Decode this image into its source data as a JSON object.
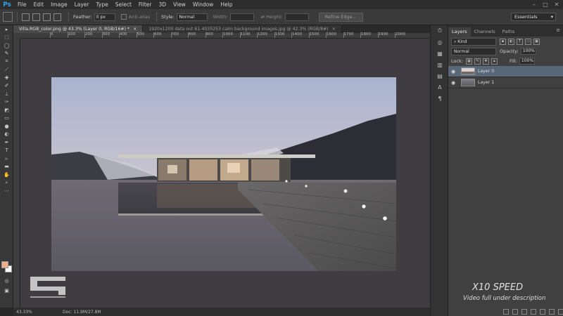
{
  "app": {
    "logo": "Ps"
  },
  "menu": [
    "File",
    "Edit",
    "Image",
    "Layer",
    "Type",
    "Select",
    "Filter",
    "3D",
    "View",
    "Window",
    "Help"
  ],
  "options": {
    "feather_label": "Feather:",
    "feather_value": "0 px",
    "antialias_label": "Anti-alias",
    "style_label": "Style:",
    "style_value": "Normal",
    "width_label": "Width:",
    "height_label": "Height:",
    "refine_edge": "Refine Edge...",
    "workspace": "Essentials"
  },
  "doc_tabs": [
    {
      "label": "Villa.RGB_color.png @ 43.3% (Layer 0, RGB/16#) *",
      "close": "×"
    },
    {
      "label": "1920x1200 data out 61-4035253 calm background images.jpg @ 42.3% (RGB/8#)",
      "close": "×"
    }
  ],
  "ruler": {
    "labels": [
      "0",
      "100",
      "200",
      "300",
      "400",
      "500",
      "600",
      "700",
      "800",
      "900",
      "1000",
      "1100",
      "1200",
      "1300",
      "1400",
      "1500",
      "1600",
      "1700",
      "1800",
      "1900",
      "2000"
    ]
  },
  "status": {
    "zoom": "43.33%",
    "doc": "Doc: 11.9M/27.8M"
  },
  "panel": {
    "tabs": [
      "Layers",
      "Channels",
      "Paths"
    ],
    "kind": "Kind",
    "blend_mode": "Normal",
    "opacity_label": "Opacity:",
    "opacity_value": "100%",
    "lock_label": "Lock:",
    "fill_label": "Fill:",
    "fill_value": "100%",
    "layers": [
      {
        "name": "Layer 0",
        "selected": true
      },
      {
        "name": "Layer 1",
        "selected": false
      }
    ]
  },
  "overlay": {
    "speed": "X10 SPEED",
    "subtitle": "Video full under description"
  },
  "colors": {
    "foreground": "#f0b08a",
    "background": "#ffffff",
    "accent": "#2fa3f0"
  }
}
